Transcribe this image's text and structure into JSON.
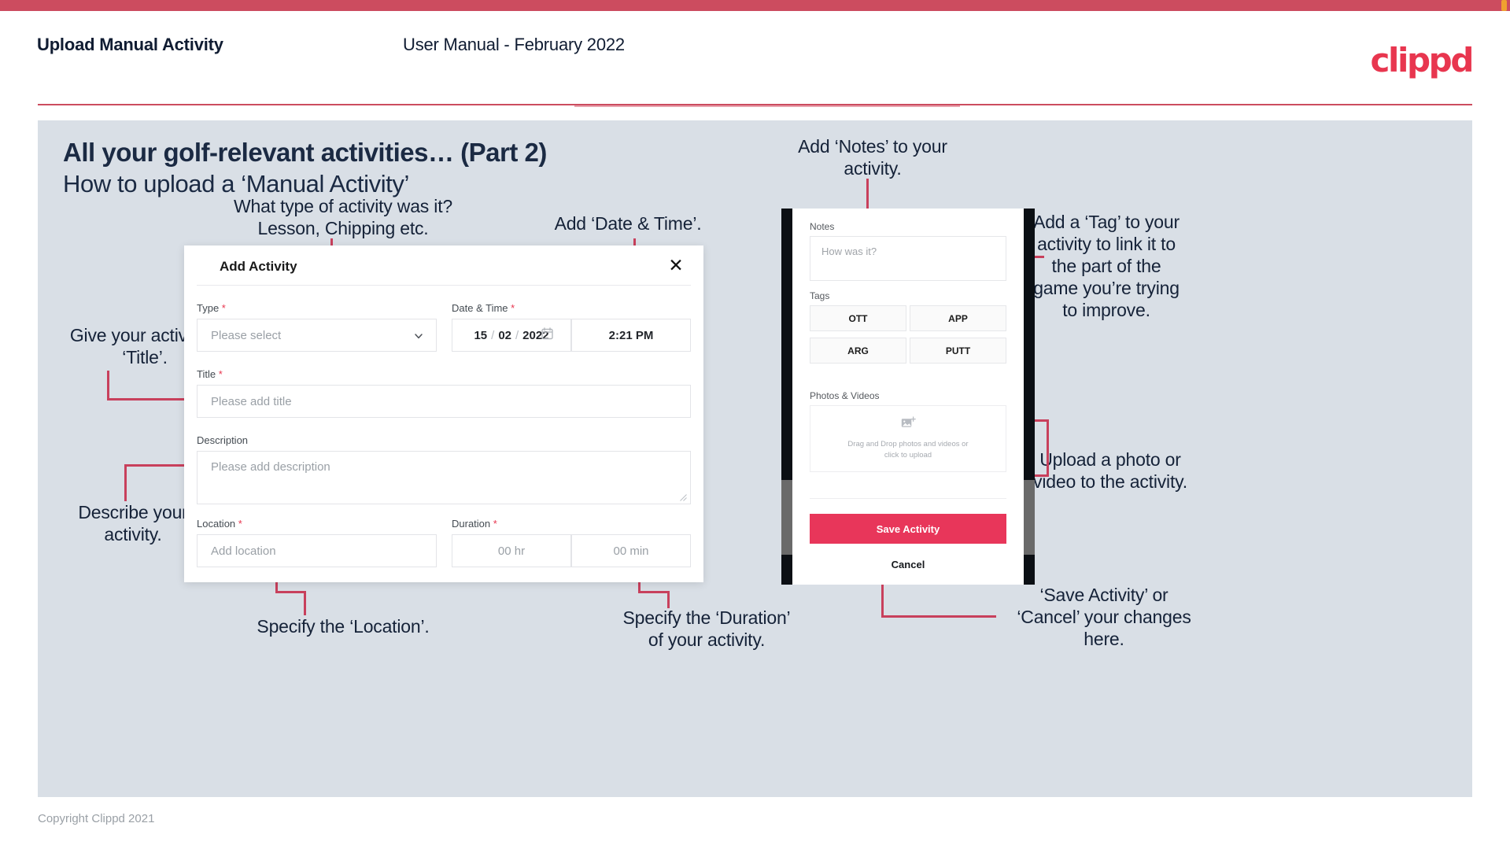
{
  "header": {
    "left_title": "Upload Manual Activity",
    "center_title": "User Manual - February 2022",
    "logo": "clippd"
  },
  "slide": {
    "title": "All your golf-relevant activities… (Part 2)",
    "subtitle": "How to upload a ‘Manual Activity’"
  },
  "annotations": {
    "type": "What type of activity was it?\nLesson, Chipping etc.",
    "date_time": "Add ‘Date & Time’.",
    "notes": "Add ‘Notes’ to your\nactivity.",
    "tag": "Add a ‘Tag’ to your\nactivity to link it to\nthe part of the\ngame you’re trying\nto improve.",
    "title_field": "Give your activity a\n‘Title’.",
    "description": "Describe your\nactivity.",
    "location": "Specify the ‘Location’.",
    "duration": "Specify the ‘Duration’\nof your activity.",
    "upload": "Upload a photo or\nvideo to the activity.",
    "save_cancel": "‘Save Activity’ or\n‘Cancel’ your changes\nhere."
  },
  "dialog": {
    "title": "Add Activity",
    "close_icon": "close-icon",
    "fields": {
      "type": {
        "label": "Type",
        "required": true,
        "placeholder": "Please select",
        "value": ""
      },
      "date_time": {
        "label": "Date & Time",
        "required": true,
        "day": "15",
        "month": "02",
        "year": "2022",
        "separator": "/",
        "time": "2:21 PM"
      },
      "title": {
        "label": "Title",
        "required": true,
        "placeholder": "Please add title",
        "value": ""
      },
      "description": {
        "label": "Description",
        "required": false,
        "placeholder": "Please add description",
        "value": ""
      },
      "location": {
        "label": "Location",
        "required": true,
        "placeholder": "Add location",
        "value": ""
      },
      "duration": {
        "label": "Duration",
        "required": true,
        "hours_placeholder": "00 hr",
        "minutes_placeholder": "00 min"
      }
    }
  },
  "phone": {
    "notes": {
      "label": "Notes",
      "placeholder": "How was it?",
      "value": ""
    },
    "tags": {
      "label": "Tags",
      "items": [
        "OTT",
        "APP",
        "ARG",
        "PUTT"
      ]
    },
    "photos": {
      "label": "Photos & Videos",
      "drop_line1": "Drag and Drop photos and videos or",
      "drop_line2": "click to upload",
      "icon": "add-image-icon"
    },
    "save_label": "Save Activity",
    "cancel_label": "Cancel"
  },
  "footer": {
    "copyright": "Copyright Clippd 2021"
  },
  "colors": {
    "brand_pink": "#e8364f",
    "save_pink": "#e8365a",
    "topbar": "#cc4c5f",
    "connector": "#c8405c",
    "panel_bg": "#d9dfe6",
    "text_dark": "#152238"
  }
}
